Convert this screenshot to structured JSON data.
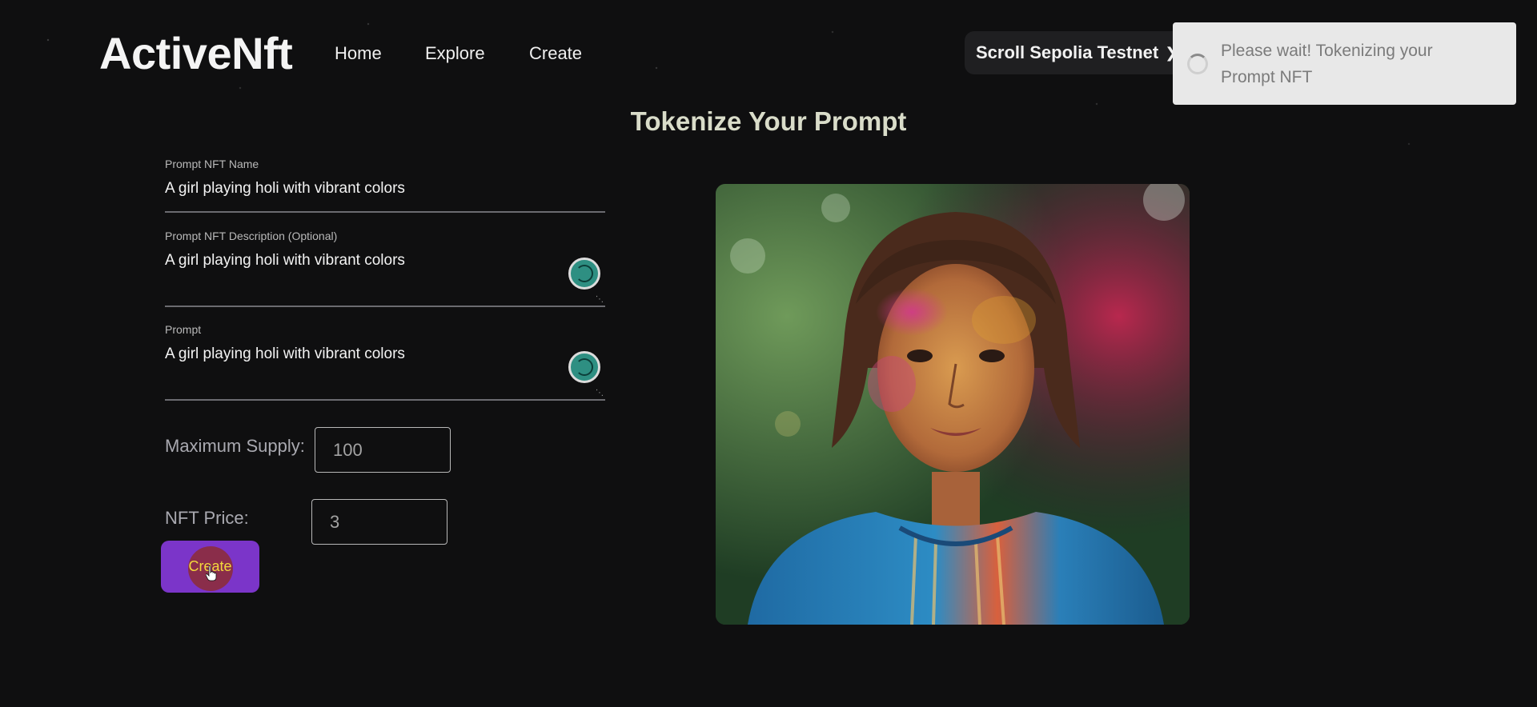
{
  "header": {
    "logo": "ActiveNft",
    "nav": [
      {
        "label": "Home"
      },
      {
        "label": "Explore"
      },
      {
        "label": "Create"
      }
    ],
    "network": "Scroll Sepolia Testnet"
  },
  "toast": {
    "message": "Please wait! Tokenizing your Prompt NFT"
  },
  "page_title": "Tokenize Your Prompt",
  "form": {
    "name": {
      "label": "Prompt NFT Name",
      "value": "A girl playing holi with vibrant colors"
    },
    "description": {
      "label": "Prompt NFT Description (Optional)",
      "value": "A girl playing holi with vibrant colors"
    },
    "prompt": {
      "label": "Prompt",
      "value": "A girl playing holi with vibrant colors"
    },
    "max_supply": {
      "label": "Maximum Supply:",
      "value": "100"
    },
    "price": {
      "label": "NFT Price:",
      "value": "3"
    },
    "submit_label": "Create"
  },
  "colors": {
    "background": "#0f0f10",
    "accent_purple": "#7b35c9",
    "title": "#d9dcc9",
    "ai_button": "#2e8f82"
  }
}
